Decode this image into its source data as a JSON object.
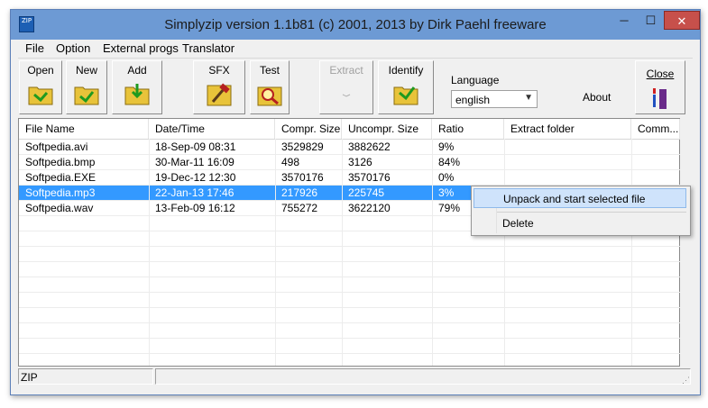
{
  "window": {
    "title": "Simplyzip version 1.1b81 (c) 2001, 2013 by Dirk Paehl freeware",
    "app_icon_text": "ZIP"
  },
  "window_controls": {
    "minimize": "─",
    "maximize": "☐",
    "close": "✕"
  },
  "menu": [
    "File",
    "Option",
    "External progs",
    "Translator"
  ],
  "toolbar": {
    "open": "Open",
    "new": "New",
    "add": "Add",
    "sfx": "SFX",
    "test": "Test",
    "extract": "Extract",
    "identify": "Identify",
    "close": "Close",
    "language_label": "Language",
    "language_value": "english",
    "about": "About"
  },
  "table": {
    "columns": [
      "File Name",
      "Date/Time",
      "Compr. Size",
      "Uncompr. Size",
      "Ratio",
      "Extract folder",
      "Comm..."
    ],
    "rows": [
      [
        "Softpedia.avi",
        "18-Sep-09  08:31",
        "3529829",
        "3882622",
        "9%",
        "",
        ""
      ],
      [
        "Softpedia.bmp",
        "30-Mar-11  16:09",
        "498",
        "3126",
        "84%",
        "",
        ""
      ],
      [
        "Softpedia.EXE",
        "19-Dec-12  12:30",
        "3570176",
        "3570176",
        "0%",
        "",
        ""
      ],
      [
        "Softpedia.mp3",
        "22-Jan-13  17:46",
        "217926",
        "225745",
        "3%",
        "",
        ""
      ],
      [
        "Softpedia.wav",
        "13-Feb-09  16:12",
        "755272",
        "3622120",
        "79%",
        "",
        ""
      ]
    ],
    "selected_row": 3
  },
  "context_menu": {
    "items": [
      "Unpack and start selected file",
      "Delete"
    ]
  },
  "status": {
    "format": "ZIP"
  },
  "colors": {
    "selection": "#3399ff",
    "titlebar": "#6d9ad4",
    "close_button": "#c7504b"
  }
}
